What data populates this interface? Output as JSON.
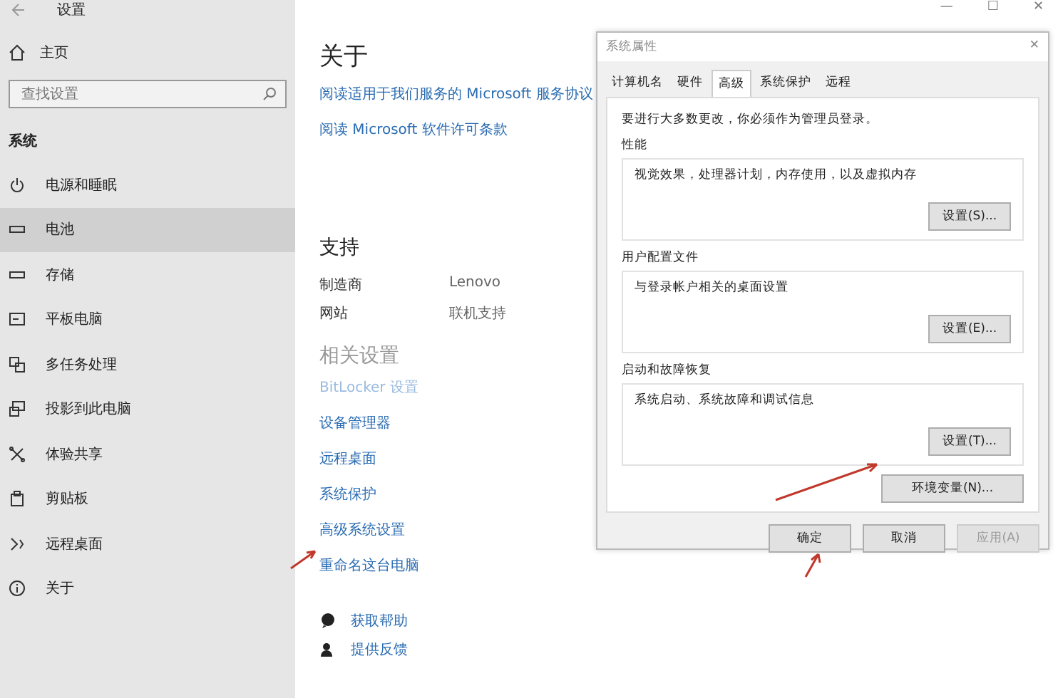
{
  "window": {
    "title": "设置",
    "controls": [
      "—",
      "☐",
      "✕"
    ]
  },
  "sidebar": {
    "home": "主页",
    "search": {
      "placeholder": "查找设置"
    },
    "section": "系统",
    "items": [
      {
        "label": "电源和睡眠",
        "selected": false
      },
      {
        "label": "电池",
        "selected": true
      },
      {
        "label": "存储",
        "selected": false
      },
      {
        "label": "平板电脑",
        "selected": false
      },
      {
        "label": "多任务处理",
        "selected": false
      },
      {
        "label": "投影到此电脑",
        "selected": false
      },
      {
        "label": "体验共享",
        "selected": false
      },
      {
        "label": "剪贴板",
        "selected": false
      },
      {
        "label": "远程桌面",
        "selected": false
      },
      {
        "label": "关于",
        "selected": false
      }
    ]
  },
  "main": {
    "title": "关于",
    "links": [
      "阅读适用于我们服务的 Microsoft 服务协议",
      "阅读 Microsoft 软件许可条款"
    ],
    "support": {
      "title": "支持",
      "rows": [
        {
          "label": "制造商",
          "value": "Lenovo"
        },
        {
          "label": "网站",
          "value": "联机支持"
        }
      ]
    },
    "related": {
      "title": "相关设置",
      "links": [
        {
          "label": "BitLocker 设置",
          "disabled": true
        },
        {
          "label": "设备管理器",
          "disabled": false
        },
        {
          "label": "远程桌面",
          "disabled": false
        },
        {
          "label": "系统保护",
          "disabled": false
        },
        {
          "label": "高级系统设置",
          "disabled": false
        },
        {
          "label": "重命名这台电脑",
          "disabled": false
        }
      ]
    },
    "help": [
      "获取帮助",
      "提供反馈"
    ]
  },
  "dialog": {
    "title": "系统属性",
    "close": "✕",
    "tabs": [
      {
        "label": "计算机名",
        "selected": false
      },
      {
        "label": "硬件",
        "selected": false
      },
      {
        "label": "高级",
        "selected": true
      },
      {
        "label": "系统保护",
        "selected": false
      },
      {
        "label": "远程",
        "selected": false
      }
    ],
    "notice": "要进行大多数更改，你必须作为管理员登录。",
    "groups": [
      {
        "title": "性能",
        "text": "视觉效果，处理器计划，内存使用，以及虚拟内存",
        "button": "设置(S)..."
      },
      {
        "title": "用户配置文件",
        "text": "与登录帐户相关的桌面设置",
        "button": "设置(E)..."
      },
      {
        "title": "启动和故障恢复",
        "text": "系统启动、系统故障和调试信息",
        "button": "设置(T)..."
      }
    ],
    "env_button": "环境变量(N)...",
    "footer": [
      {
        "label": "确定",
        "disabled": false
      },
      {
        "label": "取消",
        "disabled": false
      },
      {
        "label": "应用(A)",
        "disabled": true
      }
    ]
  }
}
